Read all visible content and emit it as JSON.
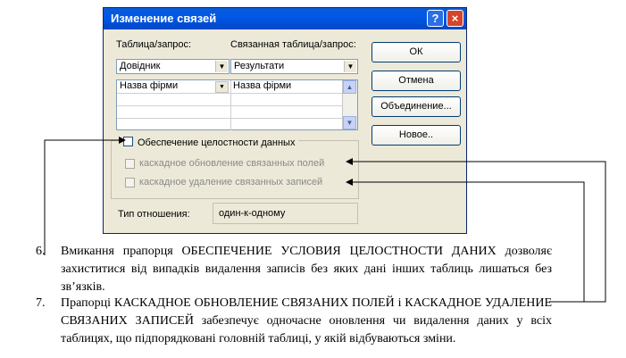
{
  "dialog": {
    "title": "Изменение связей",
    "help_label": "?",
    "close_label": "×",
    "table_label": "Таблица/запрос:",
    "related_label": "Связанная таблица/запрос:",
    "table_value": "Довідник",
    "related_value": "Результати",
    "grid": {
      "left_field": "Назва фірми",
      "right_field": "Назва фірми"
    },
    "integrity_label": "Обеспечение целостности данных",
    "cascade_update_label": "каскадное обновление связанных полей",
    "cascade_delete_label": "каскадное удаление связанных записей",
    "relation_type_label": "Тип отношения:",
    "relation_type_value": "один-к-одному",
    "buttons": {
      "ok": "ОК",
      "cancel": "Отмена",
      "join": "Объединение...",
      "new": "Новое.."
    }
  },
  "notes": [
    {
      "number": "6.",
      "text": "Вмикання прапорця ОБЕСПЕЧЕНИЕ УСЛОВИЯ ЦЕЛОСТНОСТИ ДАНИХ дозволяє захиститися від випадків видалення записів без яких дані інших таблиць лишаться без зв’язків."
    },
    {
      "number": "7.",
      "text": "Прапорці КАСКАДНОЕ ОБНОВЛЕНИЕ СВЯЗАНИХ ПОЛЕЙ і КАСКАДНОЕ УДАЛЕНИЕ СВЯЗАНИХ ЗАПИСЕЙ забезпечує одночасне оновлення чи видалення даних у всіх таблицях, що підпорядковані головній таблиці, у якій відбуваються зміни."
    }
  ]
}
